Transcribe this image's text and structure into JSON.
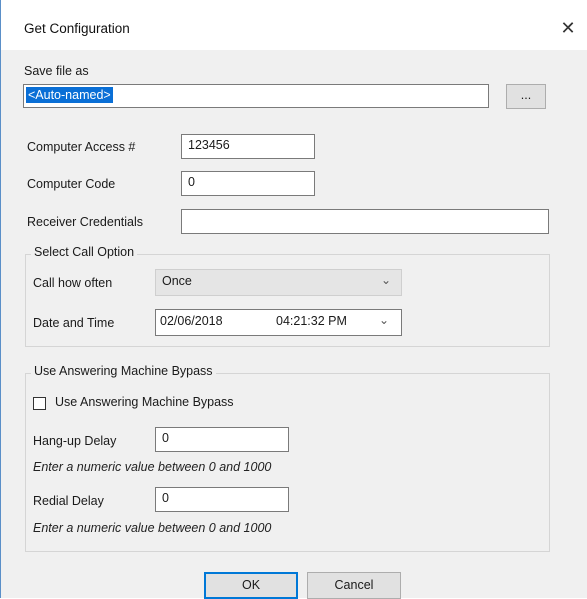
{
  "window": {
    "title": "Get Configuration",
    "close_symbol": "✕"
  },
  "save": {
    "label": "Save file as",
    "value": "<Auto-named>",
    "browse_label": "..."
  },
  "access": {
    "label": "Computer Access #",
    "value": "123456"
  },
  "code": {
    "label": "Computer Code",
    "value": "0"
  },
  "credentials": {
    "label": "Receiver Credentials",
    "value": ""
  },
  "call_option": {
    "group_title": "Select Call Option",
    "how_often_label": "Call how often",
    "how_often_value": "Once",
    "date_time_label": "Date and Time",
    "date_value": "02/06/2018",
    "time_value": "04:21:32 PM"
  },
  "bypass": {
    "group_title": "Use Answering Machine Bypass",
    "checkbox_label": "Use Answering Machine Bypass",
    "checked": false,
    "hangup_label": "Hang-up Delay",
    "hangup_value": "0",
    "hangup_hint": "Enter a numeric value between 0 and 1000",
    "redial_label": "Redial Delay",
    "redial_value": "0",
    "redial_hint": "Enter a numeric value between 0 and 1000"
  },
  "buttons": {
    "ok": "OK",
    "cancel": "Cancel"
  }
}
